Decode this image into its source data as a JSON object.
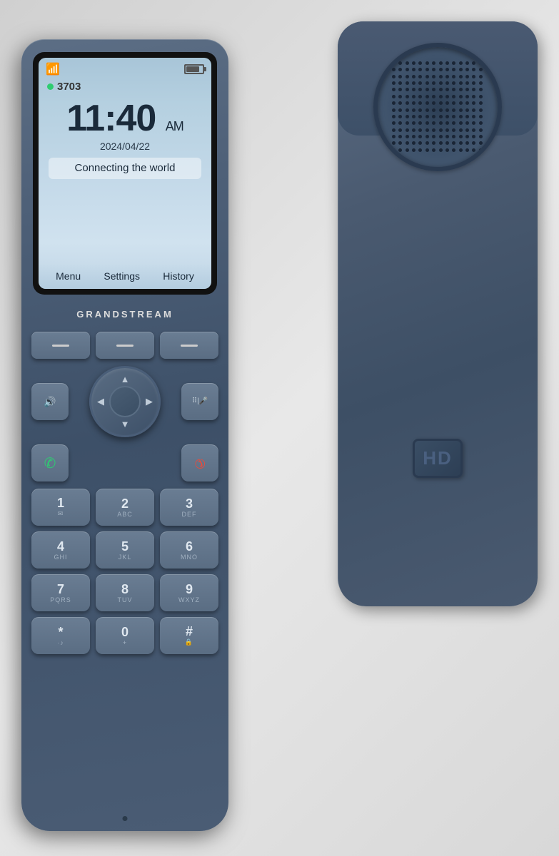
{
  "scene": {
    "bg": "#e0e4e8"
  },
  "handset": {
    "brand": "GRANDSTREAM",
    "screen": {
      "extension": "3703",
      "time": "11:40",
      "ampm": "AM",
      "date": "2024/04/22",
      "motto": "Connecting the world",
      "softkey_left": "Menu",
      "softkey_mid": "Settings",
      "softkey_right": "History"
    },
    "keypad": {
      "soft1": "—",
      "soft2": "—",
      "soft3": "—",
      "keys": [
        {
          "digit": "1",
          "sub": "✉"
        },
        {
          "digit": "2",
          "sub": "ABC"
        },
        {
          "digit": "3",
          "sub": "DEF"
        },
        {
          "digit": "4",
          "sub": "GHI"
        },
        {
          "digit": "5",
          "sub": "JKL"
        },
        {
          "digit": "6",
          "sub": "MNO"
        },
        {
          "digit": "7",
          "sub": "PQRS"
        },
        {
          "digit": "8",
          "sub": "TUV"
        },
        {
          "digit": "9",
          "sub": "WXYZ"
        },
        {
          "digit": "*",
          "sub": "·♪"
        },
        {
          "digit": "0",
          "sub": "+"
        },
        {
          "digit": "#",
          "sub": "🔒"
        }
      ]
    },
    "hd_badge": "HD"
  }
}
